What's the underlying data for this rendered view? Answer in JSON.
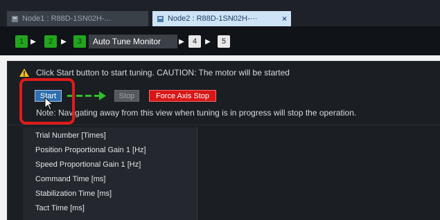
{
  "tabs": [
    {
      "label": "Node1 : R88D-1SN02H-...",
      "active": false
    },
    {
      "label": "Node2 : R88D-1SN02H-···",
      "active": true,
      "close": "×"
    }
  ],
  "steps": {
    "items": [
      "1",
      "2",
      "3",
      "4",
      "5"
    ],
    "current_label": "Auto Tune Monitor",
    "chevron": "▶"
  },
  "warning": {
    "icon": "warning-triangle-icon",
    "text": "Click Start button to start tuning. CAUTION: The motor will be started"
  },
  "buttons": {
    "start": "Start",
    "stop": "Stop",
    "force_stop": "Force Axis Stop"
  },
  "note": "Note: Navigating away from this view when tuning is in progress will stop the operation.",
  "parameters": [
    "Trial Number [Times]",
    "Position Proportional Gain 1 [Hz]",
    "Speed Proportional Gain 1 [Hz]",
    "Command Time [ms]",
    "Stabilization Time [ms]",
    "Tact Time [ms]"
  ],
  "colors": {
    "accent": "#2f6fb0",
    "done_step": "#22a51e",
    "danger": "#d81616",
    "highlight": "#e01b1b"
  }
}
